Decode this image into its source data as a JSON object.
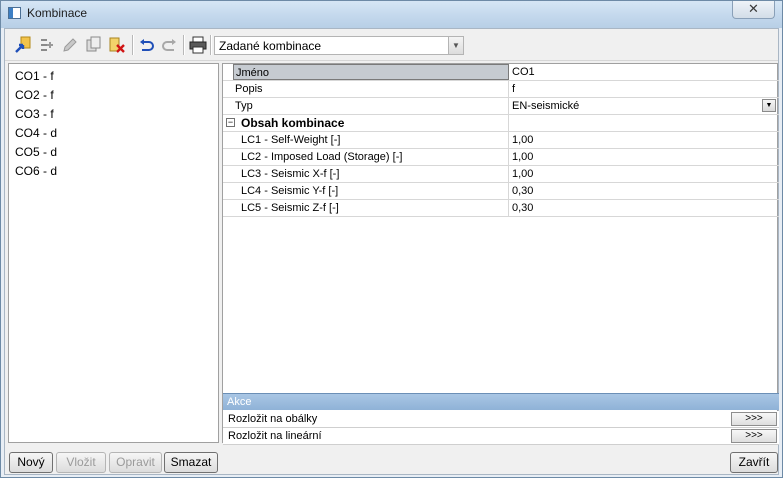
{
  "window": {
    "title": "Kombinace",
    "close_label": "✕"
  },
  "toolbar": {
    "icons": [
      "new-icon",
      "insert-icon",
      "edit-icon",
      "copy-icon",
      "delete-icon",
      "undo-icon",
      "redo-icon",
      "print-icon"
    ],
    "selector_value": "Zadané kombinace",
    "selector_arrow": "▼"
  },
  "combinations": [
    {
      "label": "CO1 - f"
    },
    {
      "label": "CO2 - f"
    },
    {
      "label": "CO3 - f"
    },
    {
      "label": "CO4 - d"
    },
    {
      "label": "CO5 - d"
    },
    {
      "label": "CO6 - d"
    }
  ],
  "properties": {
    "name_label": "Jméno",
    "name_value": "CO1",
    "desc_label": "Popis",
    "desc_value": "f",
    "type_label": "Typ",
    "type_value": "EN-seismické",
    "type_arrow": "▼",
    "section_label": "Obsah kombinace",
    "section_toggle": "−",
    "load_cases": [
      {
        "name": "LC1 - Self-Weight [-]",
        "value": "1,00"
      },
      {
        "name": "LC2 - Imposed Load (Storage) [-]",
        "value": "1,00"
      },
      {
        "name": "LC3 - Seismic X-f [-]",
        "value": "1,00"
      },
      {
        "name": "LC4 - Seismic Y-f [-]",
        "value": "0,30"
      },
      {
        "name": "LC5 - Seismic Z-f [-]",
        "value": "0,30"
      }
    ]
  },
  "actions": {
    "header": "Akce",
    "items": [
      {
        "label": "Rozložit na obálky",
        "button": ">>>"
      },
      {
        "label": "Rozložit na lineární",
        "button": ">>>"
      }
    ]
  },
  "buttons": {
    "new": "Nový",
    "insert": "Vložit",
    "edit": "Opravit",
    "delete": "Smazat",
    "close": "Zavřít"
  },
  "colors": {
    "action_header": "#9dbcdf",
    "selected_cell": "#c6cbd1"
  }
}
